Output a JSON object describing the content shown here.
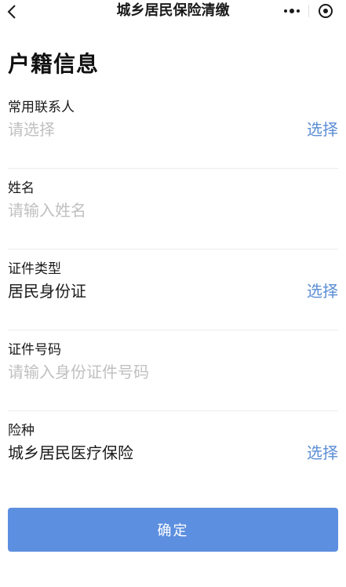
{
  "navbar": {
    "title": "城乡居民保险清缴",
    "back_icon": "chevron-left-icon",
    "more_icon": "more-dots-icon",
    "close_icon": "target-circle-icon"
  },
  "page": {
    "heading": "户籍信息"
  },
  "form": {
    "contact": {
      "label": "常用联系人",
      "placeholder": "请选择",
      "action": "选择"
    },
    "name": {
      "label": "姓名",
      "placeholder": "请输入姓名"
    },
    "id_type": {
      "label": "证件类型",
      "value": "居民身份证",
      "action": "选择"
    },
    "id_number": {
      "label": "证件号码",
      "placeholder": "请输入身份证件号码"
    },
    "insurance_type": {
      "label": "险种",
      "value": "城乡居民医疗保险",
      "action": "选择"
    }
  },
  "confirm_button": {
    "label": "确定"
  },
  "colors": {
    "accent": "#5d8fe0",
    "link": "#5b8ed4",
    "placeholder": "#c0c0c0",
    "text": "#1a1a1a"
  }
}
